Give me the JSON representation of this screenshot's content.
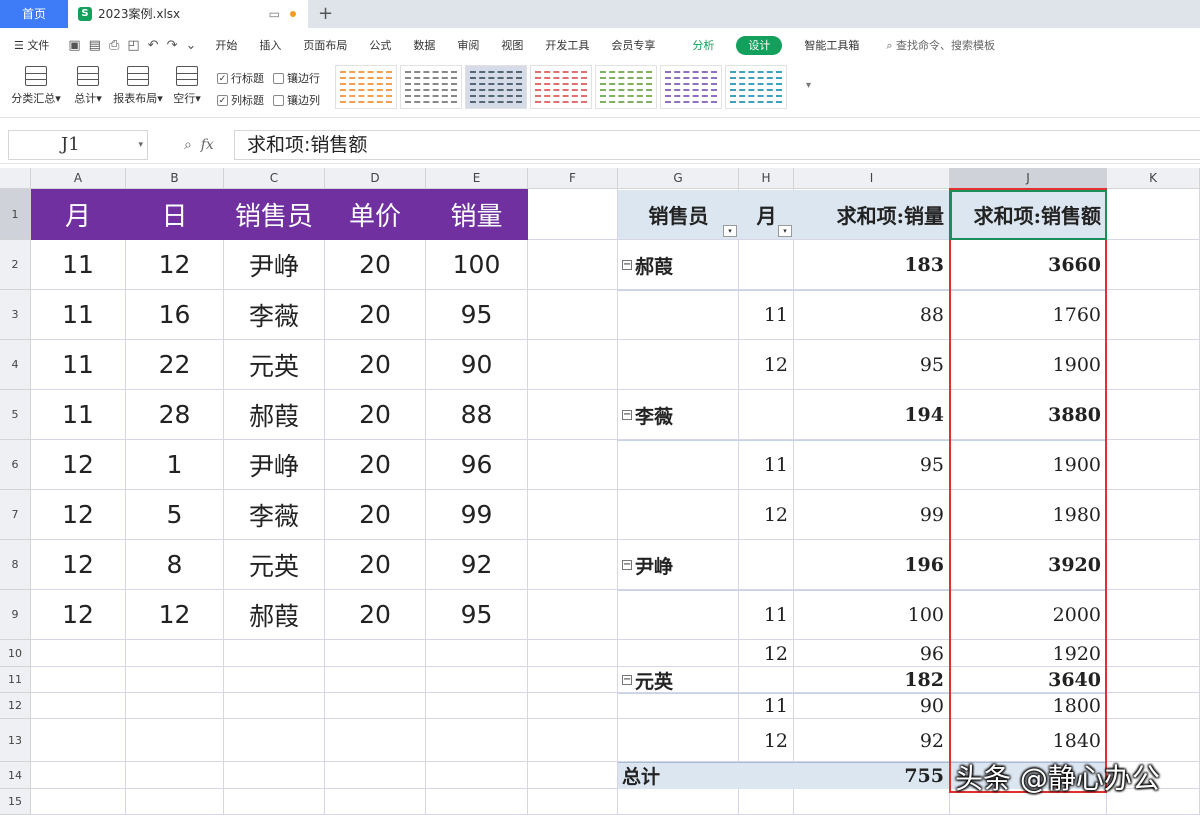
{
  "tabs": {
    "home": "首页",
    "file": "2023案例.xlsx",
    "file_logo": "S"
  },
  "menu": {
    "file": "文件",
    "items": [
      "开始",
      "插入",
      "页面布局",
      "公式",
      "数据",
      "审阅",
      "视图",
      "开发工具",
      "会员专享"
    ],
    "analyze": "分析",
    "design": "设计",
    "smart_tools": "智能工具箱",
    "search": "查找命令、搜索模板"
  },
  "ribbon": {
    "subtotal": "分类汇总",
    "grand_total": "总计",
    "report_layout": "报表布局",
    "blank_rows": "空行",
    "row_headers": "行标题",
    "col_headers": "列标题",
    "banded_rows": "镶边行",
    "banded_cols": "镶边列",
    "row_headers_checked": true,
    "col_headers_checked": true,
    "banded_rows_checked": false,
    "banded_cols_checked": false,
    "style_colors": [
      "#f0a050",
      "#888888",
      "#556677",
      "#e07070",
      "#80b060",
      "#9070c0",
      "#40a0c0"
    ]
  },
  "formula_bar": {
    "cell_ref": "J1",
    "fx": "fx",
    "content": "求和项:销售额"
  },
  "columns": [
    "A",
    "B",
    "C",
    "D",
    "E",
    "F",
    "G",
    "H",
    "I",
    "J",
    "K"
  ],
  "selected_column": "J",
  "selected_row": "1",
  "rows": [
    "1",
    "2",
    "3",
    "4",
    "5",
    "6",
    "7",
    "8",
    "9",
    "10",
    "11",
    "12",
    "13",
    "14",
    "15"
  ],
  "source_table": {
    "headers": [
      "月",
      "日",
      "销售员",
      "单价",
      "销量"
    ],
    "header_color": "#7030a0",
    "rows": [
      [
        "11",
        "12",
        "尹峥",
        "20",
        "100"
      ],
      [
        "11",
        "16",
        "李薇",
        "20",
        "95"
      ],
      [
        "11",
        "22",
        "元英",
        "20",
        "90"
      ],
      [
        "11",
        "28",
        "郝葭",
        "20",
        "88"
      ],
      [
        "12",
        "1",
        "尹峥",
        "20",
        "96"
      ],
      [
        "12",
        "5",
        "李薇",
        "20",
        "99"
      ],
      [
        "12",
        "8",
        "元英",
        "20",
        "92"
      ],
      [
        "12",
        "12",
        "郝葭",
        "20",
        "95"
      ]
    ]
  },
  "pivot": {
    "headers": [
      "销售员",
      "月",
      "求和项:销量",
      "求和项:销售额"
    ],
    "groups": [
      {
        "name": "郝葭",
        "qty": "183",
        "amount": "3660",
        "details": [
          [
            "11",
            "88",
            "1760"
          ],
          [
            "12",
            "95",
            "1900"
          ]
        ]
      },
      {
        "name": "李薇",
        "qty": "194",
        "amount": "3880",
        "details": [
          [
            "11",
            "95",
            "1900"
          ],
          [
            "12",
            "99",
            "1980"
          ]
        ]
      },
      {
        "name": "尹峥",
        "qty": "196",
        "amount": "3920",
        "details": [
          [
            "11",
            "100",
            "2000"
          ],
          [
            "12",
            "96",
            "1920"
          ]
        ]
      },
      {
        "name": "元英",
        "qty": "182",
        "amount": "3640",
        "details": [
          [
            "11",
            "90",
            "1800"
          ],
          [
            "12",
            "92",
            "1840"
          ]
        ]
      }
    ],
    "total_label": "总计",
    "total_qty": "755"
  },
  "watermark": "头条 @静心办公"
}
